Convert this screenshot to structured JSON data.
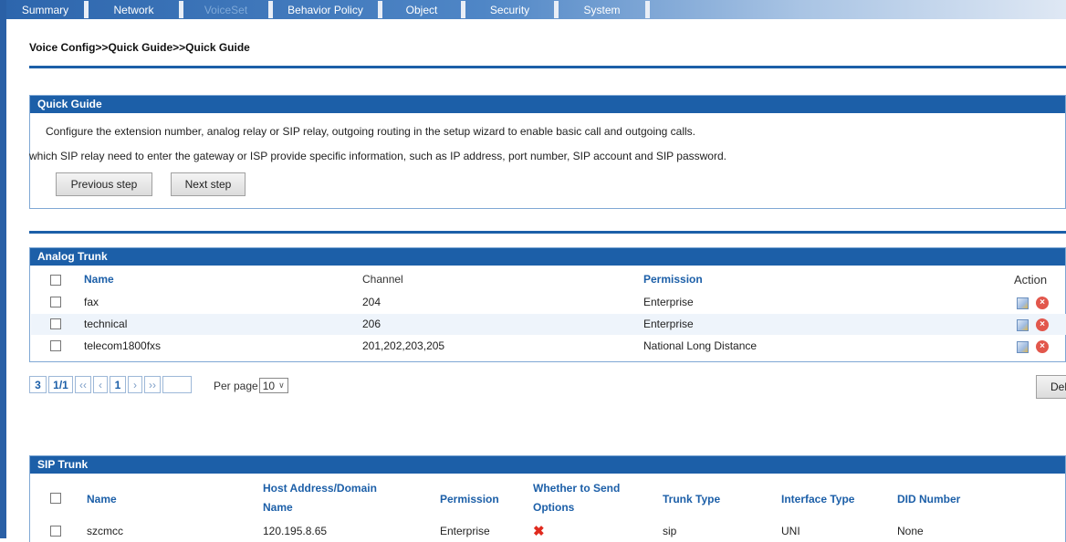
{
  "nav": {
    "tabs": [
      {
        "label": "Summary"
      },
      {
        "label": "Network"
      },
      {
        "label": "VoiceSet"
      },
      {
        "label": "Behavior Policy"
      },
      {
        "label": "Object"
      },
      {
        "label": "Security"
      },
      {
        "label": "System"
      }
    ],
    "active_tab": "VoiceSet"
  },
  "breadcrumb": "Voice Config>>Quick Guide>>Quick Guide",
  "quick_guide": {
    "title": "Quick Guide",
    "line1": "Configure the extension number, analog relay or SIP relay, outgoing routing in the setup wizard to enable basic call and outgoing calls.",
    "line2": "which SIP relay need to enter the gateway or ISP provide specific information, such as IP address, port number, SIP account and SIP password.",
    "prev_label": "Previous step",
    "next_label": "Next step"
  },
  "analog_trunk": {
    "title": "Analog Trunk",
    "columns": {
      "name": "Name",
      "channel": "Channel",
      "permission": "Permission",
      "action": "Action"
    },
    "rows": [
      {
        "name": "fax",
        "channel": "204",
        "permission": "Enterprise"
      },
      {
        "name": "technical",
        "channel": "206",
        "permission": "Enterprise"
      },
      {
        "name": "telecom1800fxs",
        "channel": "201,202,203,205",
        "permission": "National Long Distance"
      }
    ]
  },
  "pager": {
    "total": "3",
    "pages": "1/1",
    "first": "‹‹",
    "prev": "‹",
    "current": "1",
    "next": "›",
    "last": "››",
    "per_page_label": "Per page",
    "per_page_value": "10",
    "delete_label": "Del"
  },
  "sip_trunk": {
    "title": "SIP Trunk",
    "columns": {
      "name": "Name",
      "host_line1": "Host Address/Domain",
      "host_line2": "Name",
      "permission": "Permission",
      "options_line1": "Whether to Send",
      "options_line2": "Options",
      "trunk_type": "Trunk Type",
      "interface_type": "Interface Type",
      "did": "DID Number"
    },
    "rows": [
      {
        "name": "szcmcc",
        "host": "120.195.8.65",
        "permission": "Enterprise",
        "send_options": "✖",
        "trunk_type": "sip",
        "interface_type": "UNI",
        "did": "None"
      }
    ]
  },
  "colors": {
    "accent": "#1c5fa8",
    "delete": "#e2574c",
    "x_mark": "#e02a1e"
  }
}
